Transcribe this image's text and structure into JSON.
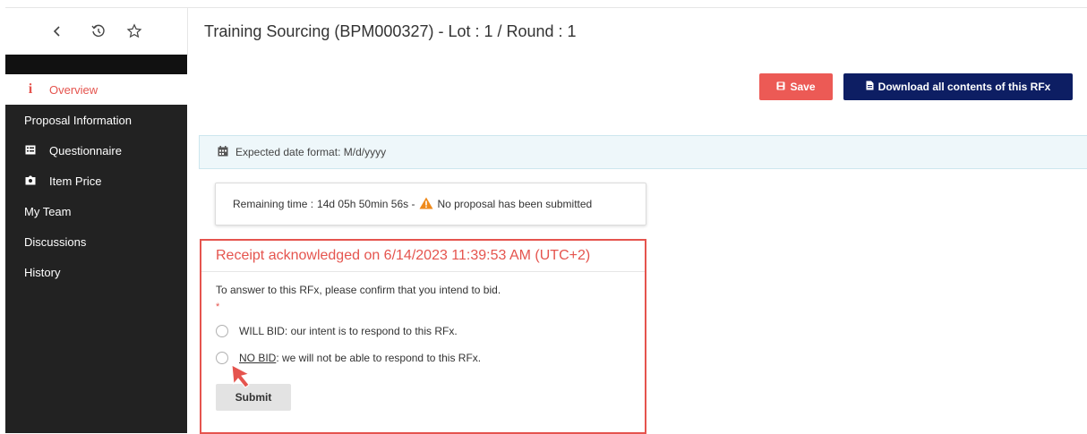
{
  "header": {
    "title": "Training Sourcing (BPM000327) - Lot : 1 / Round : 1",
    "icons": [
      "back-icon",
      "history-icon",
      "star-icon"
    ]
  },
  "sidebar": {
    "items": [
      {
        "label": "Overview",
        "icon": "info-icon",
        "active": true
      },
      {
        "label": "Proposal Information"
      },
      {
        "label": "Questionnaire",
        "icon": "list-icon"
      },
      {
        "label": "Item Price",
        "icon": "pricetag-icon"
      },
      {
        "label": "My Team"
      },
      {
        "label": "Discussions"
      },
      {
        "label": "History"
      }
    ]
  },
  "toolbar": {
    "save_label": "Save",
    "download_label": "Download all contents of this RFx"
  },
  "info": {
    "date_format": "Expected date format: M/d/yyyy"
  },
  "remaining": {
    "label": "Remaining time :",
    "value": "14d 05h 50min 56s -",
    "warning": "No proposal has been submitted"
  },
  "receipt": {
    "title": "Receipt acknowledged on 6/14/2023 11:39:53 AM (UTC+2)",
    "instruction": "To answer to this RFx, please confirm that you intend to bid.",
    "required_mark": "*",
    "option_will_bid": "WILL BID: our intent is to respond to this RFx.",
    "option_no_bid_key": "NO BID",
    "option_no_bid_rest": ": we will not be able to respond to this RFx.",
    "submit_label": "Submit"
  },
  "colors": {
    "accent_red": "#e5544e",
    "save_button": "#ec5a55",
    "download_button": "#0d1e63",
    "sidebar_bg": "#222222"
  }
}
